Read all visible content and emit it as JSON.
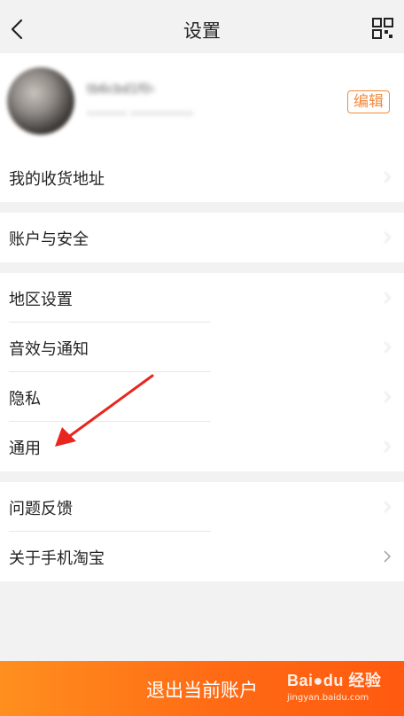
{
  "header": {
    "title": "设置",
    "back_icon": "chevron-left-icon",
    "right_icon": "qr-code-icon"
  },
  "profile": {
    "nickname": "tb6cbd1f0›",
    "uid": "••••••• •••••••••••",
    "edit_label": "编辑",
    "accent_color": "#f08a3c"
  },
  "groups": [
    {
      "items": [
        {
          "label": "我的收货地址"
        }
      ]
    },
    {
      "items": [
        {
          "label": "账户与安全"
        }
      ]
    },
    {
      "items": [
        {
          "label": "地区设置"
        },
        {
          "label": "音效与通知"
        },
        {
          "label": "隐私"
        },
        {
          "label": "通用"
        }
      ]
    },
    {
      "items": [
        {
          "label": "问题反馈"
        },
        {
          "label": "关于手机淘宝"
        }
      ]
    }
  ],
  "logout": {
    "label": "退出当前账户",
    "color": "#ff6a14"
  },
  "watermark": {
    "brand": "Bai●du 经验",
    "url": "jingyan.baidu.com"
  },
  "annotation": {
    "type": "red-arrow",
    "points_to": "通用",
    "color": "#e8261f"
  }
}
